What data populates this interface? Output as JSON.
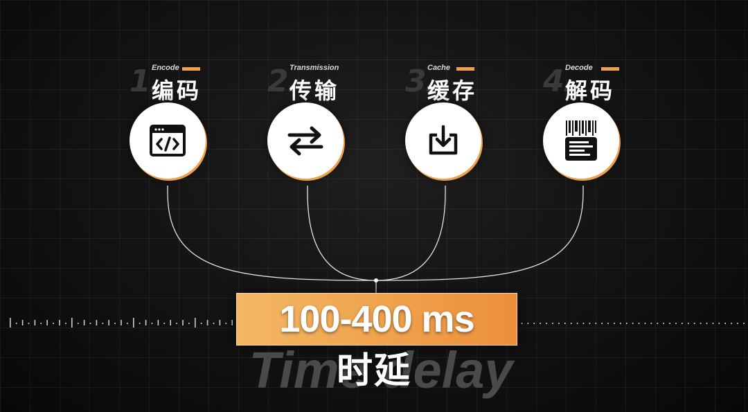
{
  "steps": [
    {
      "number": "1.",
      "label_en": "Encode",
      "label_zh": "编码",
      "icon": "code-window-icon"
    },
    {
      "number": "2.",
      "label_en": "Transmission",
      "label_zh": "传输",
      "icon": "transfer-arrows-icon"
    },
    {
      "number": "3.",
      "label_en": "Cache",
      "label_zh": "缓存",
      "icon": "download-tray-icon"
    },
    {
      "number": "4.",
      "label_en": "Decode",
      "label_zh": "解码",
      "icon": "decode-document-icon"
    }
  ],
  "result": {
    "value": "100-400 ms",
    "caption_zh": "时延",
    "caption_en": "Time delay"
  },
  "colors": {
    "accent": "#f0a04a",
    "background": "#121212",
    "line": "#e6e6e6"
  }
}
